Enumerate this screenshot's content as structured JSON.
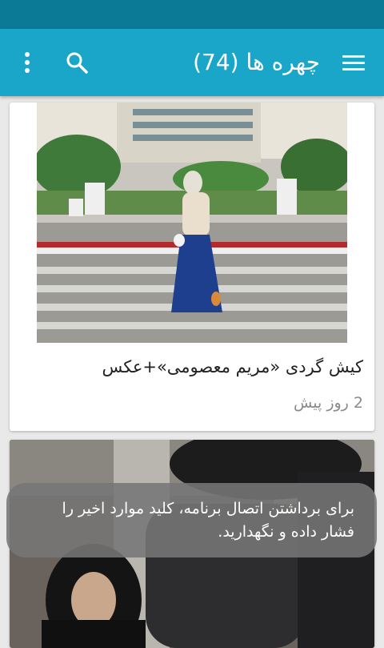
{
  "app_bar": {
    "title": "چهره ها (74)",
    "menu_icon": "hamburger-menu-icon",
    "search_icon": "search-icon",
    "overflow_icon": "more-vert-icon",
    "color": "#1aa6c9",
    "status_bar_color": "#0b7a96"
  },
  "cards": [
    {
      "title": "کیش گردی «مریم معصومی»+عکس",
      "time": "2 روز پیش"
    }
  ],
  "toast": {
    "line1": "برای برداشتن اتصال برنامه، کلید موارد اخیر را",
    "line2": "فشار داده و نگهدارید."
  }
}
